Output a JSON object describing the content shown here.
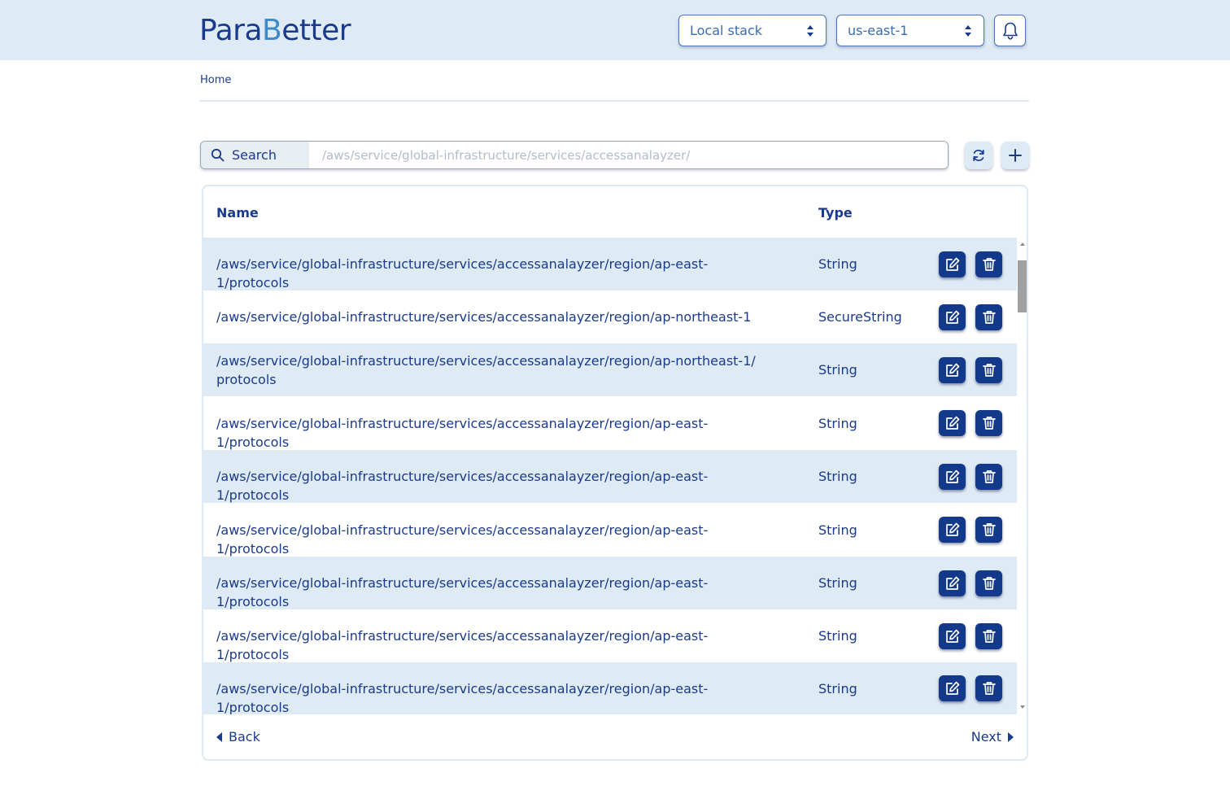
{
  "app": {
    "logo_text_part1": "Para",
    "logo_text_accent": "B",
    "logo_text_part2": "etter"
  },
  "header": {
    "stack_select": {
      "value": "Local stack"
    },
    "region_select": {
      "value": "us-east-1"
    },
    "notifications_icon": "bell-icon"
  },
  "breadcrumb": {
    "home": "Home"
  },
  "search": {
    "label": "Search",
    "placeholder": "/aws/service/global-infrastructure/services/accessanalayzer/"
  },
  "toolbar": {
    "refresh_icon": "refresh-icon",
    "add_icon": "plus-icon"
  },
  "table": {
    "columns": {
      "name": "Name",
      "type": "Type"
    },
    "rows": [
      {
        "name": "/aws/service/global-infrastructure/services/accessanalayzer/region/ap-east-1/protocols",
        "type": "String"
      },
      {
        "name": "/aws/service/global-infrastructure/services/accessanalayzer/region/ap-northeast-1",
        "type": "SecureString"
      },
      {
        "name": "/aws/service/global-infrastructure/services/accessanalayzer/region/ap-northeast-1/ protocols",
        "type": "String"
      },
      {
        "name": "/aws/service/global-infrastructure/services/accessanalayzer/region/ap-east-1/protocols",
        "type": "String"
      },
      {
        "name": "/aws/service/global-infrastructure/services/accessanalayzer/region/ap-east-1/protocols",
        "type": "String"
      },
      {
        "name": "/aws/service/global-infrastructure/services/accessanalayzer/region/ap-east-1/protocols",
        "type": "String"
      },
      {
        "name": "/aws/service/global-infrastructure/services/accessanalayzer/region/ap-east-1/protocols",
        "type": "String"
      },
      {
        "name": "/aws/service/global-infrastructure/services/accessanalayzer/region/ap-east-1/protocols",
        "type": "String"
      },
      {
        "name": "/aws/service/global-infrastructure/services/accessanalayzer/region/ap-east-1/protocols",
        "type": "String"
      }
    ],
    "row_actions": {
      "edit_icon": "edit-icon",
      "delete_icon": "trash-icon"
    }
  },
  "pagination": {
    "back": "Back",
    "next": "Next"
  },
  "colors": {
    "primary": "#1a3a8c",
    "header_bg": "#deeaf4",
    "row_alt_bg": "#deeaf4",
    "action_button": "#133a8a",
    "logo_accent": "#3d8ac8"
  }
}
